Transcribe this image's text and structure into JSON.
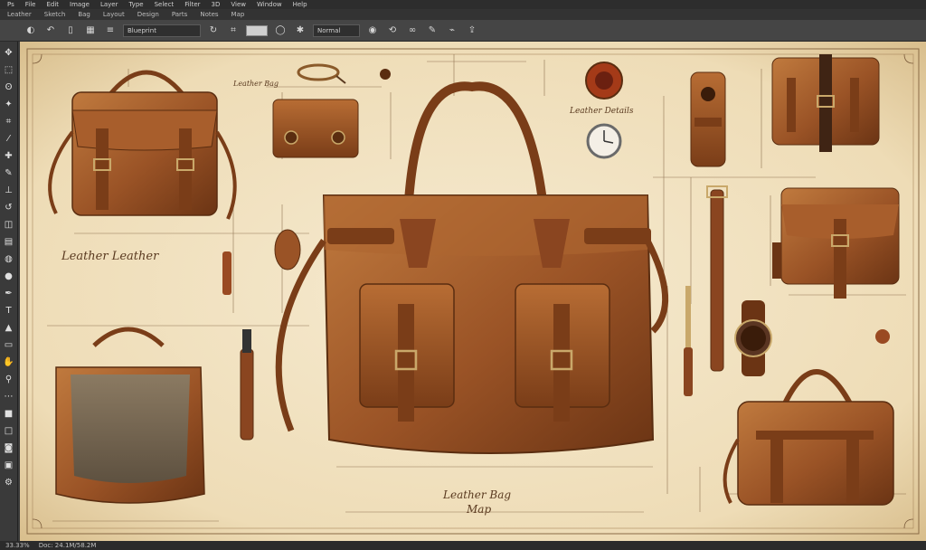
{
  "menubar": {
    "items": [
      "Ps",
      "File",
      "Edit",
      "Image",
      "Layer",
      "Type",
      "Select",
      "Filter",
      "3D",
      "View",
      "Window",
      "Help"
    ]
  },
  "tabbar": {
    "items": [
      "Leather",
      "Sketch",
      "Bag",
      "Layout",
      "Design",
      "Parts",
      "Notes",
      "Map"
    ]
  },
  "options": {
    "preset_field": "Blueprint",
    "mode_field": "Normal"
  },
  "canvas": {
    "main_title": "Leather Bag",
    "main_title_sub": "Map",
    "annotation_left": "Leather Leather",
    "annotation_top": "Leather Details",
    "annotation_mid": "Leather Bag"
  },
  "statusbar": {
    "zoom": "33.33%",
    "doc_info": "Doc: 24.1M/58.2M"
  },
  "colors": {
    "parchment": "#f2e3c4",
    "leather": "#9a5326",
    "leather_dark": "#6b3414",
    "ink": "#5a3a20"
  }
}
